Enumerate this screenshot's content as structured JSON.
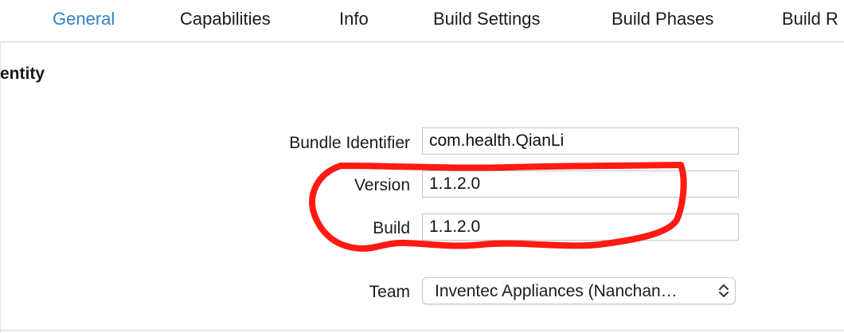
{
  "tabs": [
    {
      "label": "General",
      "active": true
    },
    {
      "label": "Capabilities",
      "active": false
    },
    {
      "label": "Info",
      "active": false
    },
    {
      "label": "Build Settings",
      "active": false
    },
    {
      "label": "Build Phases",
      "active": false
    },
    {
      "label": "Build R",
      "active": false
    }
  ],
  "section": {
    "title": "entity"
  },
  "identity": {
    "bundle_identifier_label": "Bundle Identifier",
    "bundle_identifier_value": "com.health.QianLi",
    "version_label": "Version",
    "version_value": "1.1.2.0",
    "build_label": "Build",
    "build_value": "1.1.2.0"
  },
  "signing": {
    "team_label": "Team",
    "team_value": "Inventec Appliances (Nanchan…"
  },
  "colors": {
    "active_tab": "#2d84c8",
    "annotation_stroke": "#ff1a12"
  },
  "icons": {
    "team_select": "up-down-chevron-icon"
  }
}
